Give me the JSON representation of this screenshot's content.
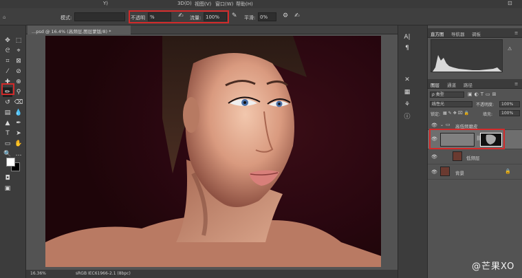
{
  "menubar": {
    "items": [
      "Y)",
      "3D(D)",
      "视图(V)",
      "窗口(W)",
      "帮助(H)"
    ]
  },
  "options": {
    "mode_label": "模式:",
    "opacity_label": "不透明",
    "opacity_value": "%",
    "flow_label": "流量:",
    "flow_value": "100%",
    "smooth_label": "平滑:",
    "smooth_value": "0%"
  },
  "document": {
    "tab_title": "...psd @ 16.4% (高频层,图层蒙版/8) *",
    "close": "×",
    "zoom": "16.36%",
    "color_profile": "sRGB IEC61966-2.1 (8bpc)"
  },
  "panels": {
    "top_tabs": [
      "直方图",
      "导航器",
      "调板"
    ],
    "layer_tabs": [
      "图层",
      "通道",
      "路径"
    ],
    "filter_kind": "类型",
    "blend_mode": "线性光",
    "opacity_label": "不透明度:",
    "opacity_value": "100%",
    "lock_label": "锁定:",
    "fill_label": "填充:",
    "fill_value": "100%",
    "layers": [
      {
        "name": "高低频磨皮",
        "type": "group"
      },
      {
        "name": "",
        "type": "high-freq"
      },
      {
        "name": "低频层",
        "type": "low-freq"
      },
      {
        "name": "背景",
        "type": "background"
      }
    ]
  },
  "watermark": "@芒果XO",
  "colors": {
    "highlight": "#d32a2a",
    "canvas_bg": "#2a0710"
  }
}
